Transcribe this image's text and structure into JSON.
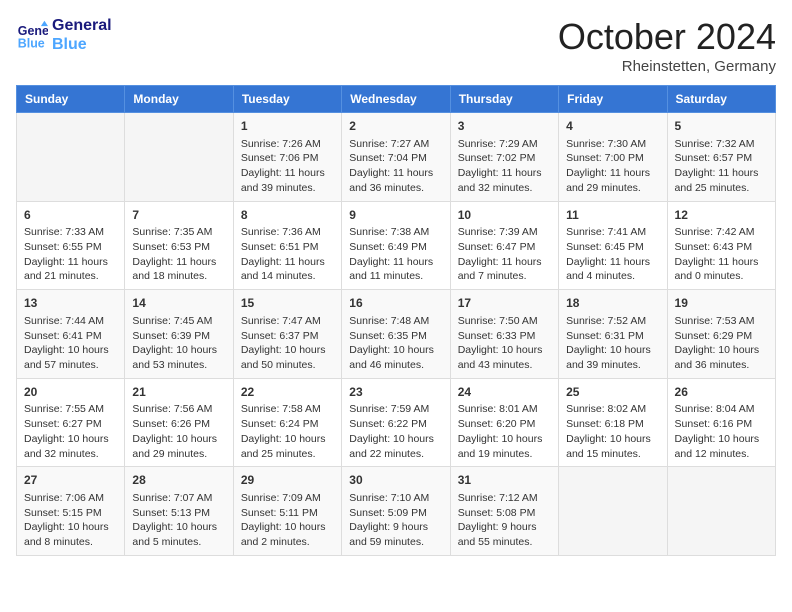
{
  "header": {
    "logo_line1": "General",
    "logo_line2": "Blue",
    "month": "October 2024",
    "location": "Rheinstetten, Germany"
  },
  "weekdays": [
    "Sunday",
    "Monday",
    "Tuesday",
    "Wednesday",
    "Thursday",
    "Friday",
    "Saturday"
  ],
  "weeks": [
    [
      {
        "day": "",
        "sunrise": "",
        "sunset": "",
        "daylight": ""
      },
      {
        "day": "",
        "sunrise": "",
        "sunset": "",
        "daylight": ""
      },
      {
        "day": "1",
        "sunrise": "Sunrise: 7:26 AM",
        "sunset": "Sunset: 7:06 PM",
        "daylight": "Daylight: 11 hours and 39 minutes."
      },
      {
        "day": "2",
        "sunrise": "Sunrise: 7:27 AM",
        "sunset": "Sunset: 7:04 PM",
        "daylight": "Daylight: 11 hours and 36 minutes."
      },
      {
        "day": "3",
        "sunrise": "Sunrise: 7:29 AM",
        "sunset": "Sunset: 7:02 PM",
        "daylight": "Daylight: 11 hours and 32 minutes."
      },
      {
        "day": "4",
        "sunrise": "Sunrise: 7:30 AM",
        "sunset": "Sunset: 7:00 PM",
        "daylight": "Daylight: 11 hours and 29 minutes."
      },
      {
        "day": "5",
        "sunrise": "Sunrise: 7:32 AM",
        "sunset": "Sunset: 6:57 PM",
        "daylight": "Daylight: 11 hours and 25 minutes."
      }
    ],
    [
      {
        "day": "6",
        "sunrise": "Sunrise: 7:33 AM",
        "sunset": "Sunset: 6:55 PM",
        "daylight": "Daylight: 11 hours and 21 minutes."
      },
      {
        "day": "7",
        "sunrise": "Sunrise: 7:35 AM",
        "sunset": "Sunset: 6:53 PM",
        "daylight": "Daylight: 11 hours and 18 minutes."
      },
      {
        "day": "8",
        "sunrise": "Sunrise: 7:36 AM",
        "sunset": "Sunset: 6:51 PM",
        "daylight": "Daylight: 11 hours and 14 minutes."
      },
      {
        "day": "9",
        "sunrise": "Sunrise: 7:38 AM",
        "sunset": "Sunset: 6:49 PM",
        "daylight": "Daylight: 11 hours and 11 minutes."
      },
      {
        "day": "10",
        "sunrise": "Sunrise: 7:39 AM",
        "sunset": "Sunset: 6:47 PM",
        "daylight": "Daylight: 11 hours and 7 minutes."
      },
      {
        "day": "11",
        "sunrise": "Sunrise: 7:41 AM",
        "sunset": "Sunset: 6:45 PM",
        "daylight": "Daylight: 11 hours and 4 minutes."
      },
      {
        "day": "12",
        "sunrise": "Sunrise: 7:42 AM",
        "sunset": "Sunset: 6:43 PM",
        "daylight": "Daylight: 11 hours and 0 minutes."
      }
    ],
    [
      {
        "day": "13",
        "sunrise": "Sunrise: 7:44 AM",
        "sunset": "Sunset: 6:41 PM",
        "daylight": "Daylight: 10 hours and 57 minutes."
      },
      {
        "day": "14",
        "sunrise": "Sunrise: 7:45 AM",
        "sunset": "Sunset: 6:39 PM",
        "daylight": "Daylight: 10 hours and 53 minutes."
      },
      {
        "day": "15",
        "sunrise": "Sunrise: 7:47 AM",
        "sunset": "Sunset: 6:37 PM",
        "daylight": "Daylight: 10 hours and 50 minutes."
      },
      {
        "day": "16",
        "sunrise": "Sunrise: 7:48 AM",
        "sunset": "Sunset: 6:35 PM",
        "daylight": "Daylight: 10 hours and 46 minutes."
      },
      {
        "day": "17",
        "sunrise": "Sunrise: 7:50 AM",
        "sunset": "Sunset: 6:33 PM",
        "daylight": "Daylight: 10 hours and 43 minutes."
      },
      {
        "day": "18",
        "sunrise": "Sunrise: 7:52 AM",
        "sunset": "Sunset: 6:31 PM",
        "daylight": "Daylight: 10 hours and 39 minutes."
      },
      {
        "day": "19",
        "sunrise": "Sunrise: 7:53 AM",
        "sunset": "Sunset: 6:29 PM",
        "daylight": "Daylight: 10 hours and 36 minutes."
      }
    ],
    [
      {
        "day": "20",
        "sunrise": "Sunrise: 7:55 AM",
        "sunset": "Sunset: 6:27 PM",
        "daylight": "Daylight: 10 hours and 32 minutes."
      },
      {
        "day": "21",
        "sunrise": "Sunrise: 7:56 AM",
        "sunset": "Sunset: 6:26 PM",
        "daylight": "Daylight: 10 hours and 29 minutes."
      },
      {
        "day": "22",
        "sunrise": "Sunrise: 7:58 AM",
        "sunset": "Sunset: 6:24 PM",
        "daylight": "Daylight: 10 hours and 25 minutes."
      },
      {
        "day": "23",
        "sunrise": "Sunrise: 7:59 AM",
        "sunset": "Sunset: 6:22 PM",
        "daylight": "Daylight: 10 hours and 22 minutes."
      },
      {
        "day": "24",
        "sunrise": "Sunrise: 8:01 AM",
        "sunset": "Sunset: 6:20 PM",
        "daylight": "Daylight: 10 hours and 19 minutes."
      },
      {
        "day": "25",
        "sunrise": "Sunrise: 8:02 AM",
        "sunset": "Sunset: 6:18 PM",
        "daylight": "Daylight: 10 hours and 15 minutes."
      },
      {
        "day": "26",
        "sunrise": "Sunrise: 8:04 AM",
        "sunset": "Sunset: 6:16 PM",
        "daylight": "Daylight: 10 hours and 12 minutes."
      }
    ],
    [
      {
        "day": "27",
        "sunrise": "Sunrise: 7:06 AM",
        "sunset": "Sunset: 5:15 PM",
        "daylight": "Daylight: 10 hours and 8 minutes."
      },
      {
        "day": "28",
        "sunrise": "Sunrise: 7:07 AM",
        "sunset": "Sunset: 5:13 PM",
        "daylight": "Daylight: 10 hours and 5 minutes."
      },
      {
        "day": "29",
        "sunrise": "Sunrise: 7:09 AM",
        "sunset": "Sunset: 5:11 PM",
        "daylight": "Daylight: 10 hours and 2 minutes."
      },
      {
        "day": "30",
        "sunrise": "Sunrise: 7:10 AM",
        "sunset": "Sunset: 5:09 PM",
        "daylight": "Daylight: 9 hours and 59 minutes."
      },
      {
        "day": "31",
        "sunrise": "Sunrise: 7:12 AM",
        "sunset": "Sunset: 5:08 PM",
        "daylight": "Daylight: 9 hours and 55 minutes."
      },
      {
        "day": "",
        "sunrise": "",
        "sunset": "",
        "daylight": ""
      },
      {
        "day": "",
        "sunrise": "",
        "sunset": "",
        "daylight": ""
      }
    ]
  ]
}
